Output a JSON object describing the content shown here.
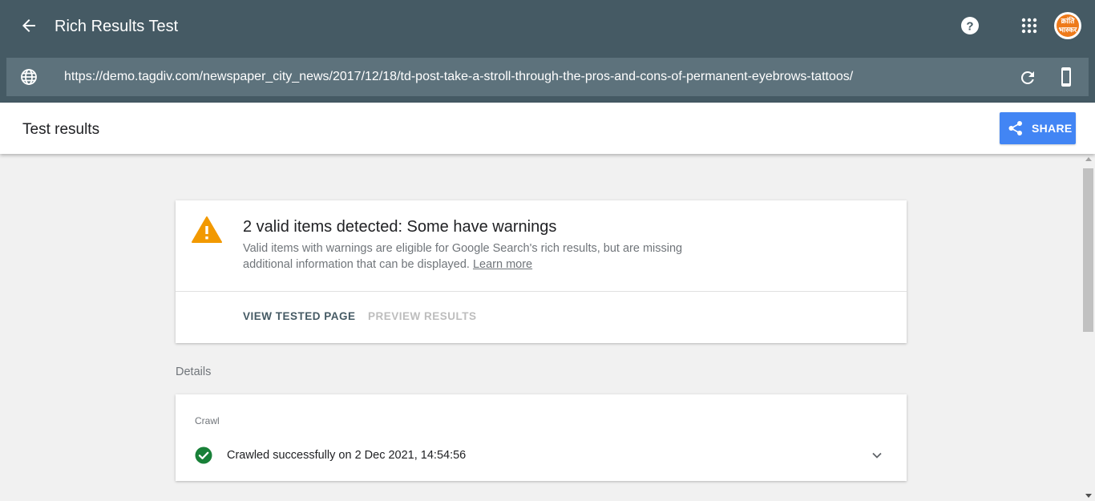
{
  "appbar": {
    "title": "Rich Results Test",
    "avatar_text": "क्रांति भास्कर"
  },
  "urlbar": {
    "url": "https://demo.tagdiv.com/newspaper_city_news/2017/12/18/td-post-take-a-stroll-through-the-pros-and-cons-of-permanent-eyebrows-tattoos/"
  },
  "results_header": {
    "title": "Test results",
    "share_label": "SHARE"
  },
  "summary": {
    "title": "2 valid items detected: Some have warnings",
    "description": "Valid items with warnings are eligible for Google Search's rich results, but are missing additional information that can be displayed.",
    "learn_more": "Learn more",
    "view_tested_page": "VIEW TESTED PAGE",
    "preview_results": "PREVIEW RESULTS"
  },
  "details": {
    "label": "Details"
  },
  "crawl": {
    "label": "Crawl",
    "status": "Crawled successfully on 2 Dec 2021, 14:54:56"
  },
  "colors": {
    "appbar": "#455a64",
    "urlbar": "#5d727c",
    "share": "#4285f4",
    "warning": "#f29900",
    "success": "#188038"
  }
}
